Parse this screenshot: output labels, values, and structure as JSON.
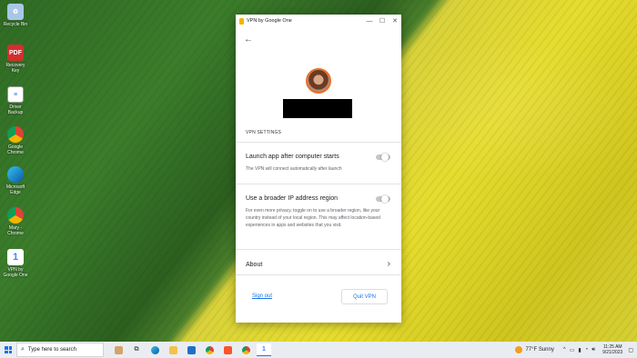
{
  "desktop": {
    "icons": [
      {
        "label": "Recycle Bin",
        "icon": "recycle-bin-icon",
        "color": "#a8c7e8"
      },
      {
        "label": "Recovery Key",
        "icon": "pdf-icon",
        "color": "#d32f2f",
        "glyph": "PDF"
      },
      {
        "label": "Driver Backup",
        "icon": "document-icon",
        "color": "#ffffff"
      },
      {
        "label": "Google Chrome",
        "icon": "chrome-icon",
        "color": "#db4437"
      },
      {
        "label": "Microsoft Edge",
        "icon": "edge-icon",
        "color": "#0c8bd6"
      },
      {
        "label": "Mary - Chrome",
        "icon": "chrome-profile-icon",
        "color": "#4285f4"
      },
      {
        "label": "VPN by Google One",
        "icon": "google-one-icon",
        "color": "#ffffff",
        "glyph": "1"
      }
    ]
  },
  "window": {
    "title": "VPN by Google One",
    "controls": {
      "minimize": "—",
      "maximize": "☐",
      "close": "✕"
    }
  },
  "settings": {
    "heading": "VPN SETTINGS",
    "launch": {
      "title": "Launch app after computer starts",
      "desc": "The VPN will connect automatically after launch",
      "enabled": false
    },
    "broader": {
      "title": "Use a broader IP address region",
      "desc": "For even more privacy, toggle on to use a broader region, like your country instead of your local region. This may affect location-based experiences in apps and websites that you visit.",
      "enabled": false
    },
    "about": "About"
  },
  "footer": {
    "sign_out": "Sign out",
    "quit": "Quit VPN"
  },
  "taskbar": {
    "search_placeholder": "Type here to search",
    "weather": "77°F  Sunny",
    "time": "11:25 AM",
    "date": "9/21/2023",
    "accent": "#1a73e8"
  }
}
